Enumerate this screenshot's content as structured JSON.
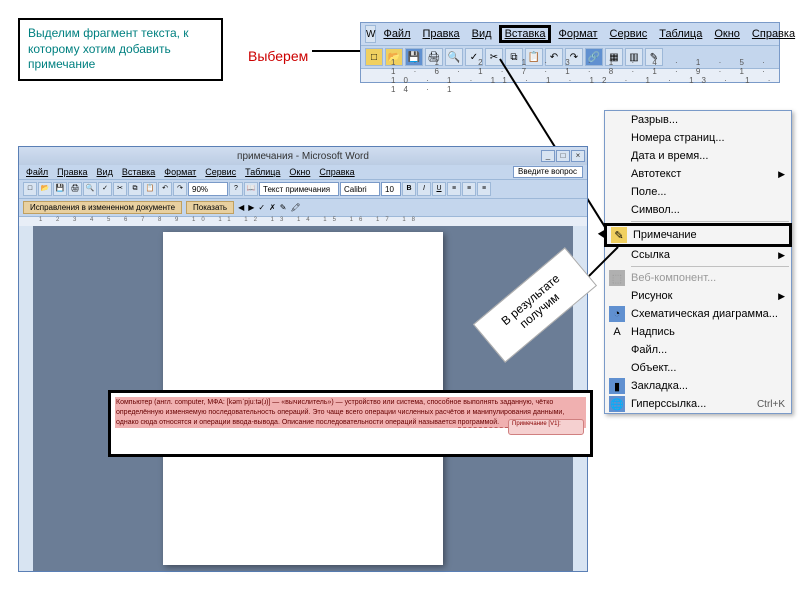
{
  "annotation": {
    "select_fragment": "Выделим фрагмент текста, к которому хотим добавить примечание",
    "choose_label": "Выберем",
    "result_label": "В результате получим"
  },
  "top_menu": {
    "items": [
      "Файл",
      "Правка",
      "Вид",
      "Вставка",
      "Формат",
      "Сервис",
      "Таблица",
      "Окно",
      "Справка"
    ],
    "highlighted_index": 3,
    "ruler_text": "1 · 1 · 2 · 1 · 3 · 1 · 4 · 1 · 5 · 1 · 6 · 1 · 7 · 1 · 8 · 1 · 9 · 1 · 10 · 1 · 11 · 1 · 12 · 1 · 13 · 1 · 14 · 1"
  },
  "dropdown": {
    "items": [
      {
        "label": "Разрыв...",
        "icon": "",
        "arrow": false
      },
      {
        "label": "Номера страниц...",
        "icon": "",
        "arrow": false
      },
      {
        "label": "Дата и время...",
        "icon": "",
        "arrow": false
      },
      {
        "label": "Автотекст",
        "icon": "",
        "arrow": true
      },
      {
        "label": "Поле...",
        "icon": "",
        "arrow": false
      },
      {
        "label": "Символ...",
        "icon": "",
        "arrow": false
      },
      {
        "label": "Примечание",
        "icon": "note",
        "arrow": false,
        "highlighted": true
      },
      {
        "label": "Ссылка",
        "icon": "",
        "arrow": true
      },
      {
        "label": "Веб-компонент...",
        "icon": "web",
        "arrow": false,
        "disabled": true
      },
      {
        "label": "Рисунок",
        "icon": "",
        "arrow": true
      },
      {
        "label": "Схематическая диаграмма...",
        "icon": "diagram",
        "arrow": false
      },
      {
        "label": "Надпись",
        "icon": "textbox",
        "arrow": false
      },
      {
        "label": "Файл...",
        "icon": "",
        "arrow": false
      },
      {
        "label": "Объект...",
        "icon": "",
        "arrow": false
      },
      {
        "label": "Закладка...",
        "icon": "bookmark",
        "arrow": false
      },
      {
        "label": "Гиперссылка...",
        "icon": "hyperlink",
        "arrow": false,
        "shortcut": "Ctrl+K"
      }
    ]
  },
  "word_window": {
    "title": "примечания - Microsoft Word",
    "menu": [
      "Файл",
      "Правка",
      "Вид",
      "Вставка",
      "Формат",
      "Сервис",
      "Таблица",
      "Окно",
      "Справка"
    ],
    "question_box": "Введите вопрос",
    "style_sel": "Текст примечания",
    "font_sel": "Calibri",
    "size_sel": "10",
    "zoom_sel": "90%",
    "review_label": "Исправления в измененном документе",
    "show_btn": "Показать",
    "ruler": "1 2 3 4 5 6 7 8 9 10 11 12 13 14 15 16 17 18"
  },
  "comment_result": {
    "text": "Компьютер (англ. computer, МФА: [kəmˈpjuːtə(ɹ)] — «вычислитель») — устройство или система, способное выполнять заданную, чётко определённую изменяемую последовательность операций. Это чаще всего операции численных расчётов и манипулирования данными, однако сюда относятся и операции ввода-вывода. Описание последовательности операций называется программой.",
    "bubble": "Примечание [V1]:"
  }
}
